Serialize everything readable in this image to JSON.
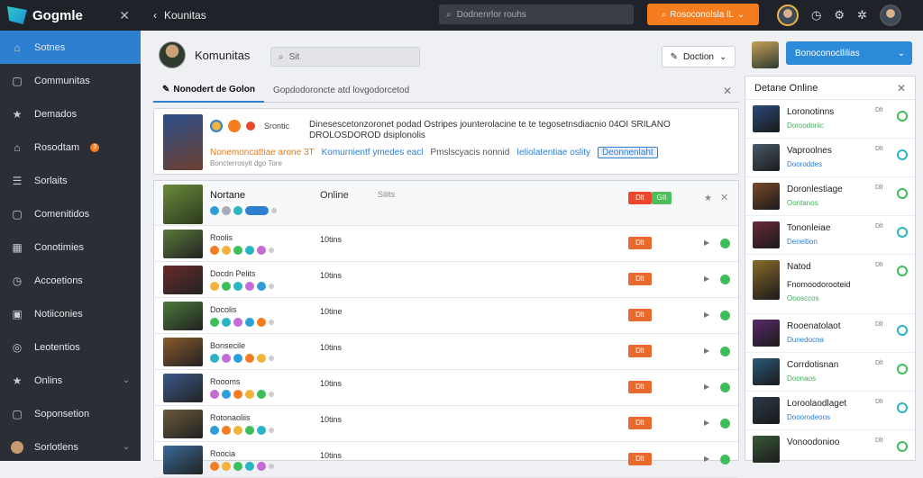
{
  "topbar": {
    "brand": "Gogmle",
    "title": "Kounitas",
    "search_text": "Dodnenrlor rouhs",
    "cta_label": "Rosoconolsla lL",
    "colors": {
      "bg": "#1f2329",
      "cta": "#f57c1f"
    }
  },
  "sidebar": {
    "items": [
      {
        "label": "Sotnes",
        "icon": "home-icon",
        "active": true
      },
      {
        "label": "Communitas",
        "icon": "square-icon"
      },
      {
        "label": "Demados",
        "icon": "star-icon"
      },
      {
        "label": "Rosodtam",
        "icon": "home-icon",
        "badge": "3"
      },
      {
        "label": "Sorlaits",
        "icon": "list-icon"
      },
      {
        "label": "Comenitidos",
        "icon": "square-icon"
      },
      {
        "label": "Conotimies",
        "icon": "grid-icon"
      },
      {
        "label": "Accoetions",
        "icon": "clock-icon"
      },
      {
        "label": "Notiiconies",
        "icon": "image-icon"
      },
      {
        "label": "Leotentios",
        "icon": "globe-icon"
      },
      {
        "label": "Onlins",
        "icon": "star-icon",
        "chevron": true
      },
      {
        "label": "Soponsetion",
        "icon": "square-icon"
      },
      {
        "label": "Sorlotlens",
        "icon": "avatar-icon",
        "chevron": true
      }
    ]
  },
  "main": {
    "title": "Komunitas",
    "search_placeholder": "Sit",
    "sort_label": "Doction",
    "tabs": [
      {
        "label": "Nonodert de Golon",
        "active": true
      },
      {
        "label": "Gopdodoroncte atd lovgodorcetod"
      }
    ],
    "announcement": {
      "author": "Srontic",
      "text": "Dinesescetonzoronet podad Ostripes jounterolacine te te tegosetnsdiacnio 04OI SRILANO DROLOSDOROD dsiplonolis",
      "line_highlight": "Nonemoncattiae arone 3T",
      "line_blue": "Komurnientf ymedes eacl",
      "line_plain": "Pmslscyacis nonnid",
      "line_blue2": "Ieliolatentiae oslity",
      "link": "Deonnenlaht",
      "sub": "Boncterrosyit dgo Tore"
    },
    "list_header": {
      "name": "Nortane",
      "status": "Online",
      "stat": "Silits",
      "tag1": "Dlt",
      "tag2": "GII"
    },
    "rows": [
      {
        "name": "Roolis",
        "status": "10tins",
        "tag": "Dlt"
      },
      {
        "name": "Docdn Pelits",
        "status": "10tins",
        "tag": "Dlt"
      },
      {
        "name": "Docolis",
        "status": "10tine",
        "tag": "Dlt"
      },
      {
        "name": "Bonsecile",
        "status": "10tins",
        "tag": "Dlt"
      },
      {
        "name": "Roooms",
        "status": "10tins",
        "tag": "Dlt"
      },
      {
        "name": "Rotonaoliis",
        "status": "10tins",
        "tag": "Dlt"
      },
      {
        "name": "Roocia",
        "status": "10tins",
        "tag": "Dlt"
      }
    ]
  },
  "right": {
    "button_label": "Bonoconocllilias",
    "panel_title": "Detane Online",
    "friends": [
      {
        "name": "Loronotinns",
        "sub": "Doroodoriic",
        "time": "Dlt"
      },
      {
        "name": "Vaproolnes",
        "sub": "Dooroddes",
        "time": "Dlt"
      },
      {
        "name": "Doronlestiage",
        "sub": "Oontanos",
        "time": "Dlt"
      },
      {
        "name": "Tononleiae",
        "sub": "Deneltion",
        "time": "Dlt"
      },
      {
        "name": "Natod",
        "sub2": "Fnomoodorooteid",
        "sub": "Ooosccos",
        "time": "Dlt"
      },
      {
        "name": "Rooenatolaot",
        "sub": "Dunedocna",
        "time": "Dlt"
      },
      {
        "name": "Corrdotisnan",
        "sub": "Doonaos",
        "time": "Dlt"
      },
      {
        "name": "Loroolaodlaget",
        "sub": "Dooorodeoos",
        "time": "Dlt"
      },
      {
        "name": "Vonoodonioo",
        "sub": "",
        "time": "Dlt"
      }
    ]
  }
}
